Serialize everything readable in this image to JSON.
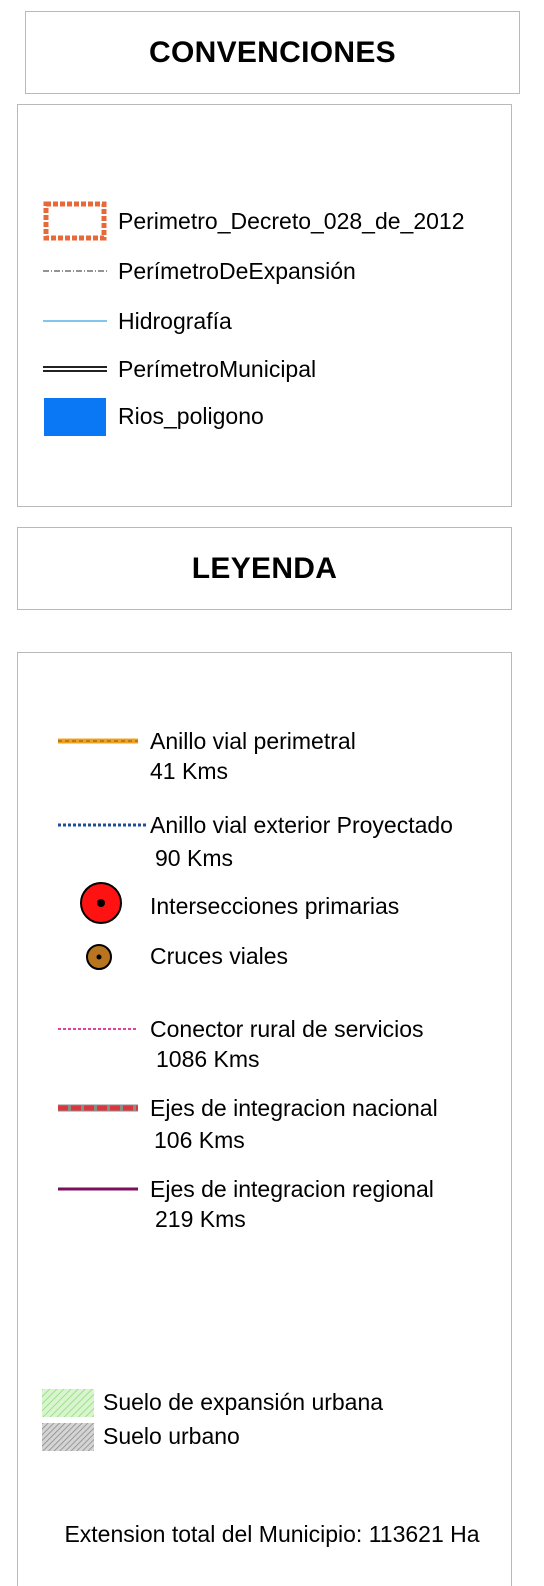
{
  "convenciones": {
    "title": "CONVENCIONES",
    "items": [
      {
        "symbol": "orange-dashed-rectangle",
        "color": "#e8683a",
        "label": "Perimetro_Decreto_028_de_2012"
      },
      {
        "symbol": "dash-dot-line",
        "color": "#555555",
        "label": "PerímetroDeExpansión"
      },
      {
        "symbol": "thin-line",
        "color": "#5ab4e6",
        "label": "Hidrografía"
      },
      {
        "symbol": "double-line",
        "color": "#222222",
        "label": "PerímetroMunicipal"
      },
      {
        "symbol": "filled-rectangle",
        "color": "#0a78f5",
        "label": "Rios_poligono"
      }
    ]
  },
  "leyenda": {
    "title": "LEYENDA",
    "items": [
      {
        "symbol": "orange-line",
        "color": "#f0a020",
        "label": "Anillo vial perimetral",
        "sub": "41 Kms"
      },
      {
        "symbol": "blue-dotted-line",
        "color": "#1f4f9a",
        "label": "Anillo vial exterior Proyectado",
        "sub": "90 Kms"
      },
      {
        "symbol": "red-circle",
        "color": "#ff1212",
        "label": "Intersecciones primarias"
      },
      {
        "symbol": "brown-circle",
        "color": "#b8741e",
        "label": "Cruces viales"
      },
      {
        "symbol": "pink-dotted-line",
        "color": "#e2409a",
        "label": "Conector rural de servicios",
        "sub": "1086 Kms"
      },
      {
        "symbol": "red-dashed-line",
        "color": "#d9363e",
        "label": "Ejes de integracion nacional",
        "sub": "106 Kms"
      },
      {
        "symbol": "purple-line",
        "color": "#7a0f5c",
        "label": "Ejes de integracion regional",
        "sub": "219 Kms"
      }
    ],
    "suelos": [
      {
        "symbol": "green-hatch",
        "color": "#9ee08a",
        "label": "Suelo de expansión urbana"
      },
      {
        "symbol": "grey-hatch",
        "color": "#8a8a8a",
        "label": "Suelo urbano"
      }
    ],
    "footer": "Extension total del Municipio: 113621 Ha"
  }
}
